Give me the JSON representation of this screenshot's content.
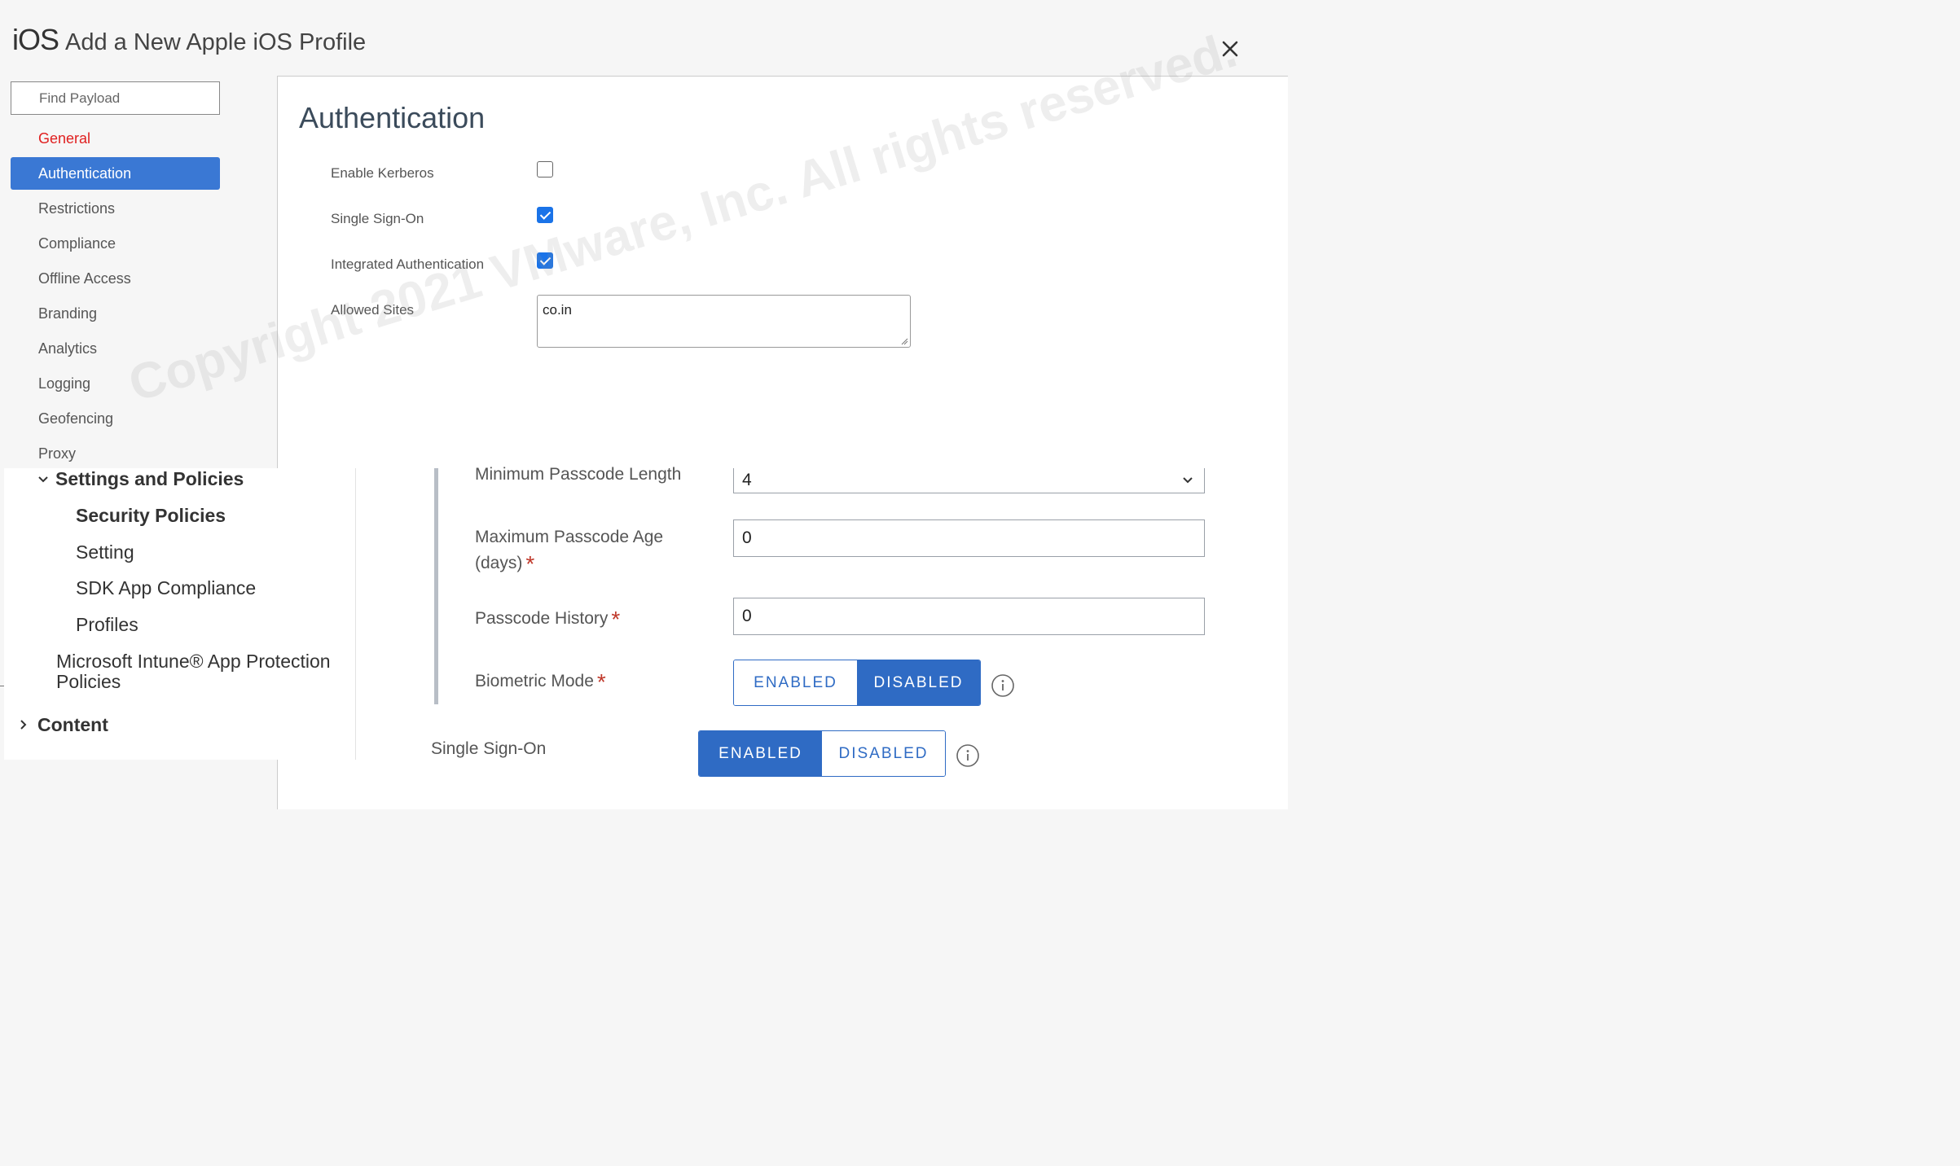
{
  "header": {
    "os_label": "iOS",
    "title": "Add a New Apple iOS Profile"
  },
  "search": {
    "placeholder": "Find Payload"
  },
  "nav": {
    "items": [
      {
        "label": "General"
      },
      {
        "label": "Authentication"
      },
      {
        "label": "Restrictions"
      },
      {
        "label": "Compliance"
      },
      {
        "label": "Offline Access"
      },
      {
        "label": "Branding"
      },
      {
        "label": "Analytics"
      },
      {
        "label": "Logging"
      },
      {
        "label": "Geofencing"
      },
      {
        "label": "Proxy"
      }
    ]
  },
  "auth": {
    "title": "Authentication",
    "enable_kerberos": {
      "label": "Enable Kerberos",
      "checked": false
    },
    "single_sign_on": {
      "label": "Single Sign-On",
      "checked": true
    },
    "integrated_auth": {
      "label": "Integrated Authentication",
      "checked": true
    },
    "allowed_sites": {
      "label": "Allowed Sites",
      "value": "co.in"
    }
  },
  "tree": {
    "settings_and_policies": "Settings and Policies",
    "security_policies": "Security Policies",
    "setting": "Setting",
    "sdk_app_compliance": "SDK App Compliance",
    "profiles": "Profiles",
    "intune_line1": "Microsoft Intune® App Protection",
    "intune_line2": "Policies",
    "content": "Content"
  },
  "passcode": {
    "min_length": {
      "label": "Minimum Passcode Length",
      "value": "4"
    },
    "max_age": {
      "label_line1": "Maximum Passcode Age",
      "label_line2": "(days)",
      "value": "0"
    },
    "history": {
      "label": "Passcode History",
      "value": "0"
    },
    "biometric": {
      "label": "Biometric Mode",
      "enabled": "ENABLED",
      "disabled": "DISABLED",
      "selected": "DISABLED"
    },
    "required_mark": "*"
  },
  "sso": {
    "label": "Single Sign-On",
    "enabled": "ENABLED",
    "disabled": "DISABLED",
    "selected": "ENABLED"
  },
  "watermark": "Copyright 2021 VMware, Inc. All rights reserved.",
  "colors": {
    "accent": "#2f6bc4",
    "active_nav": "#3a78d4",
    "general_red": "#e02020",
    "required_red": "#c0392b"
  },
  "icons": {
    "close": "close-icon",
    "info": "info-icon",
    "chevron_down": "chevron-down-icon",
    "chevron_right": "chevron-right-icon"
  }
}
